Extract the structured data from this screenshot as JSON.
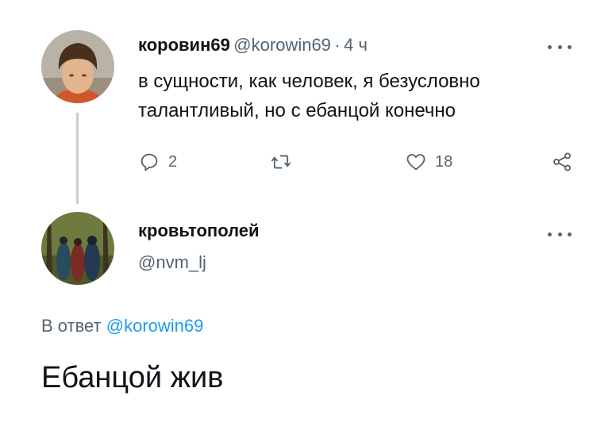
{
  "tweet1": {
    "name": "коровин69",
    "handle": "@korowin69",
    "separator": "·",
    "time": "4 ч",
    "text": "в сущности, как человек, я безусловно талантливый, но с ебанцой конечно",
    "replies": "2",
    "retweets": "",
    "likes": "18"
  },
  "tweet2": {
    "name": "кровьтополей",
    "handle": "@nvm_lj",
    "reply_prefix": "В ответ",
    "reply_to": "@korowin69",
    "text": "Ебанцой жив"
  },
  "colors": {
    "text": "#0f1419",
    "muted": "#536471",
    "link": "#1d9bf0",
    "thread_line": "#c4cfd6"
  },
  "icons": [
    "reply-icon",
    "retweet-icon",
    "like-icon",
    "share-icon",
    "more-icon"
  ]
}
